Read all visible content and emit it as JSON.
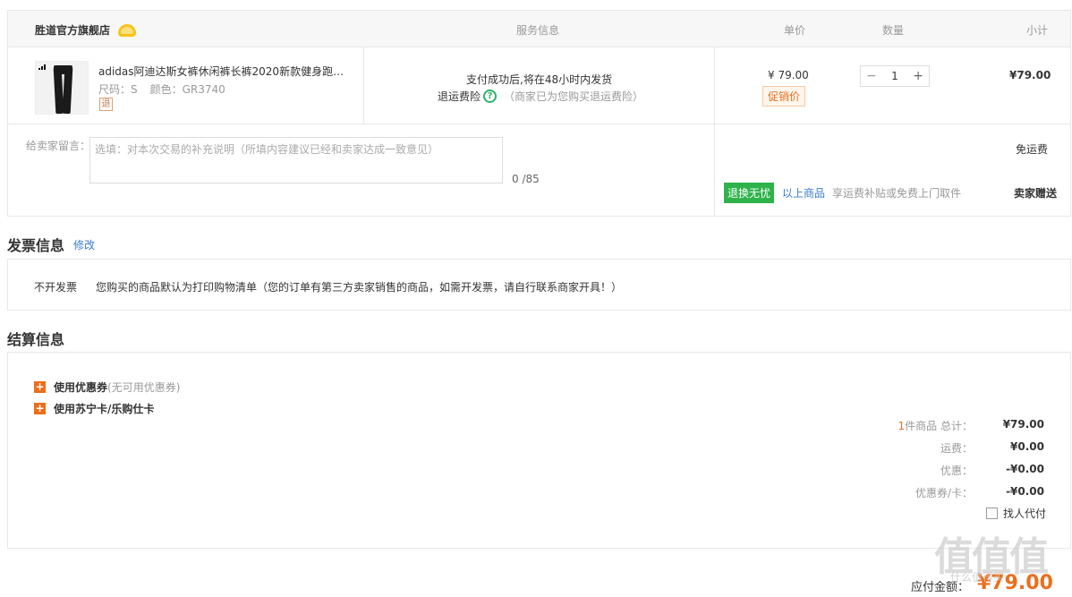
{
  "order": {
    "shop_name": "胜道官方旗舰店",
    "headers": {
      "service": "服务信息",
      "unit_price": "单价",
      "quantity": "数量",
      "subtotal": "小计"
    },
    "item": {
      "name": "adidas阿迪达斯女裤休闲裤长裤2020新款健身跑步…",
      "size_label": "尺码：S",
      "color_label": "颜色：GR3740",
      "return_tag": "退",
      "service_line1": "支付成功后,将在48小时内发货",
      "service_insurance": "退运费险",
      "service_note": "（商家已为您购买退运费险）",
      "unit_price": "¥ 79.00",
      "promo_tag": "促销价",
      "quantity": "1",
      "subtotal": "¥79.00"
    },
    "message": {
      "label": "给卖家留言：",
      "placeholder": "选填：对本次交易的补充说明（所填内容建议已经和卖家达成一致意见）",
      "count": "0 /85"
    },
    "shipping": {
      "free": "免运费",
      "tag": "退换无忧",
      "link": "以上商品",
      "note": "享运费补贴或免费上门取件",
      "gift": "卖家赠送"
    }
  },
  "invoice": {
    "title": "发票信息",
    "edit": "修改",
    "type": "不开发票",
    "note": "您购买的商品默认为打印购物清单（您的订单有第三方卖家销售的商品，如需开发票，请自行联系商家开具！）"
  },
  "settlement": {
    "title": "结算信息",
    "coupon_label": "使用优惠券",
    "coupon_note": "(无可用优惠券)",
    "card_label": "使用苏宁卡/乐购仕卡",
    "rows": [
      {
        "count": "1",
        "label": "件商品 总计：",
        "value": "¥79.00"
      },
      {
        "count": "",
        "label": "运费：",
        "value": "¥0.00"
      },
      {
        "count": "",
        "label": "优惠：",
        "value": "-¥0.00"
      },
      {
        "count": "",
        "label": "优惠券/卡：",
        "value": "-¥0.00"
      }
    ],
    "proxy_label": "找人代付"
  },
  "payment": {
    "label": "应付金额：",
    "amount": "¥79.00"
  },
  "watermark": {
    "text": "值值值",
    "sub": "什么值得买"
  }
}
